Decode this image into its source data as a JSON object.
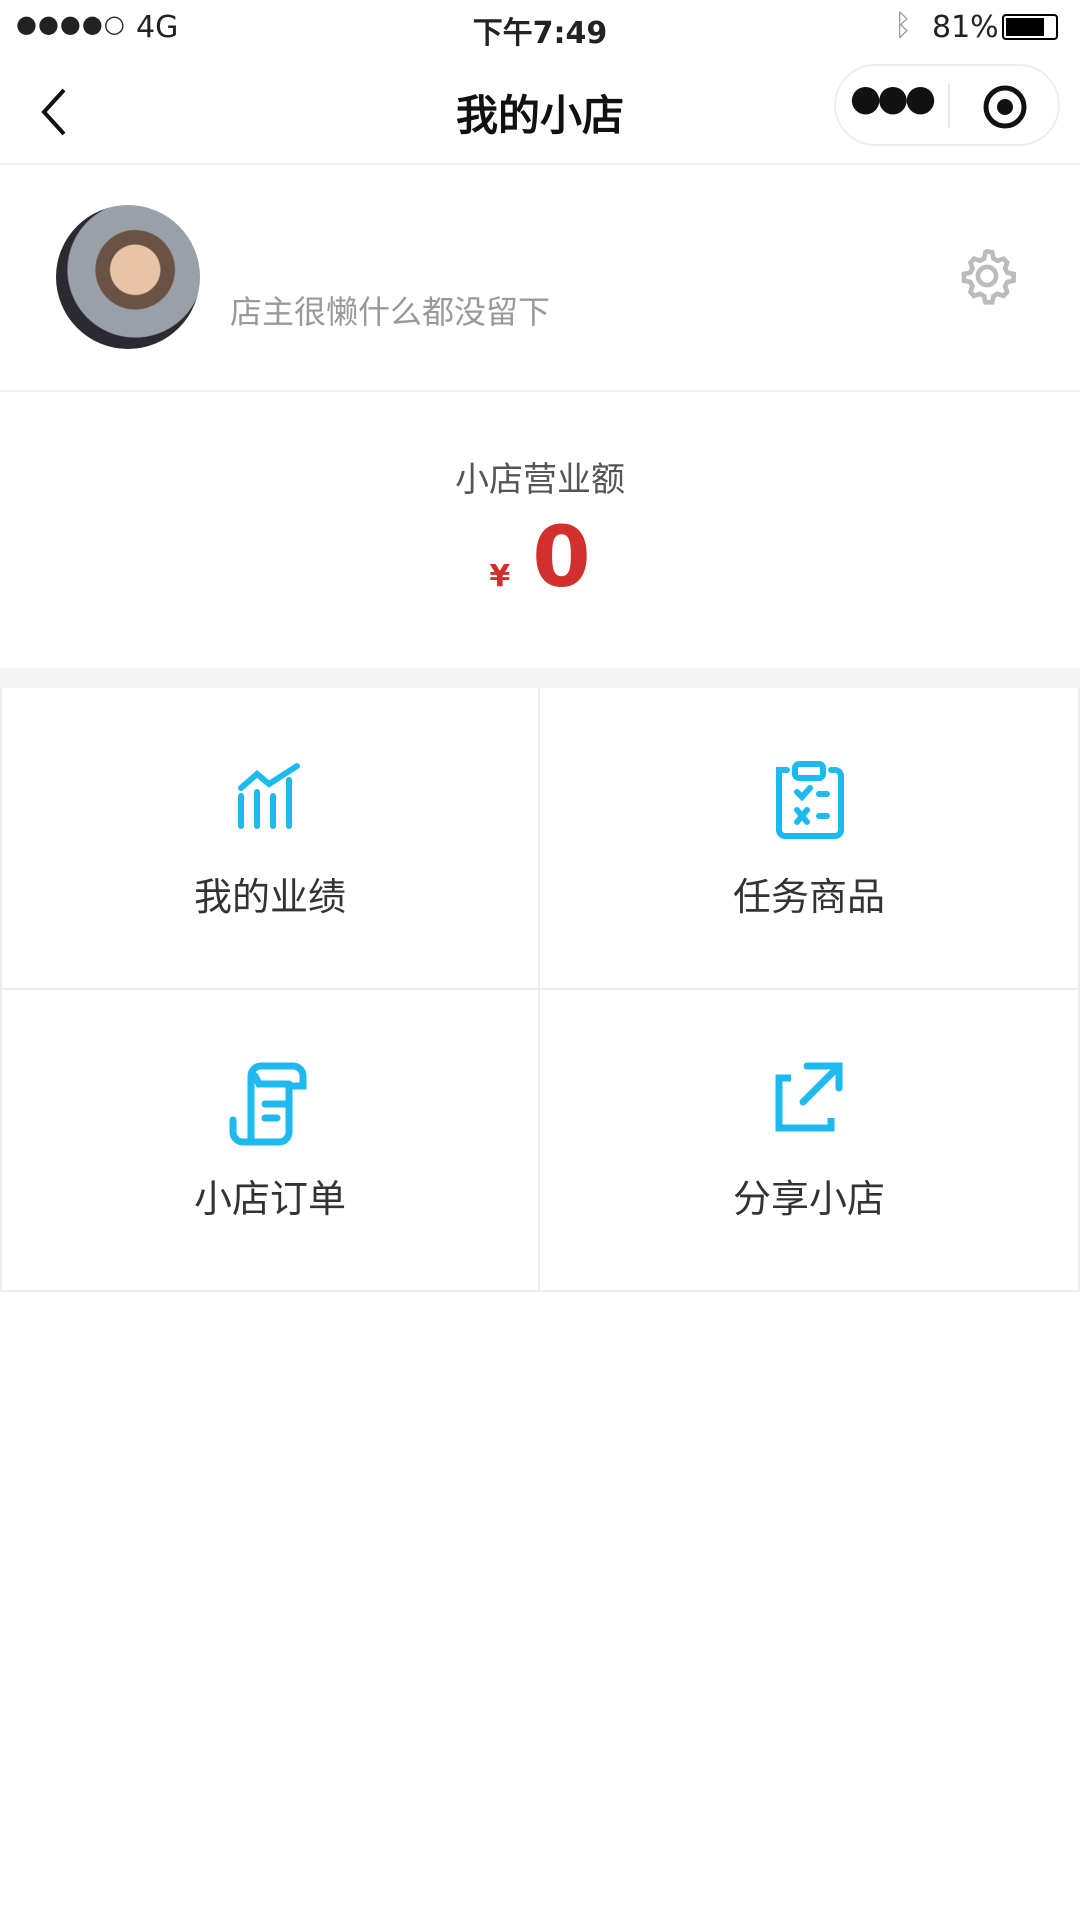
{
  "status_bar": {
    "signal": "●●●●○",
    "network": "4G",
    "time": "下午7:49",
    "battery": "81%"
  },
  "nav": {
    "title": "我的小店",
    "back_icon": "chevron-left-icon",
    "more_icon": "more-dots-icon",
    "close_icon": "target-circle-icon"
  },
  "profile": {
    "description": "店主很懒什么都没留下",
    "settings_icon": "gear-icon"
  },
  "revenue": {
    "label": "小店营业额",
    "currency": "¥",
    "amount": "0",
    "color": "#d2302c"
  },
  "grid": [
    {
      "label": "我的业绩",
      "icon": "bar-chart-icon"
    },
    {
      "label": "任务商品",
      "icon": "clipboard-checklist-icon"
    },
    {
      "label": "小店订单",
      "icon": "order-scroll-icon"
    },
    {
      "label": "分享小店",
      "icon": "share-external-icon"
    }
  ],
  "accent": "#1eb9ee"
}
